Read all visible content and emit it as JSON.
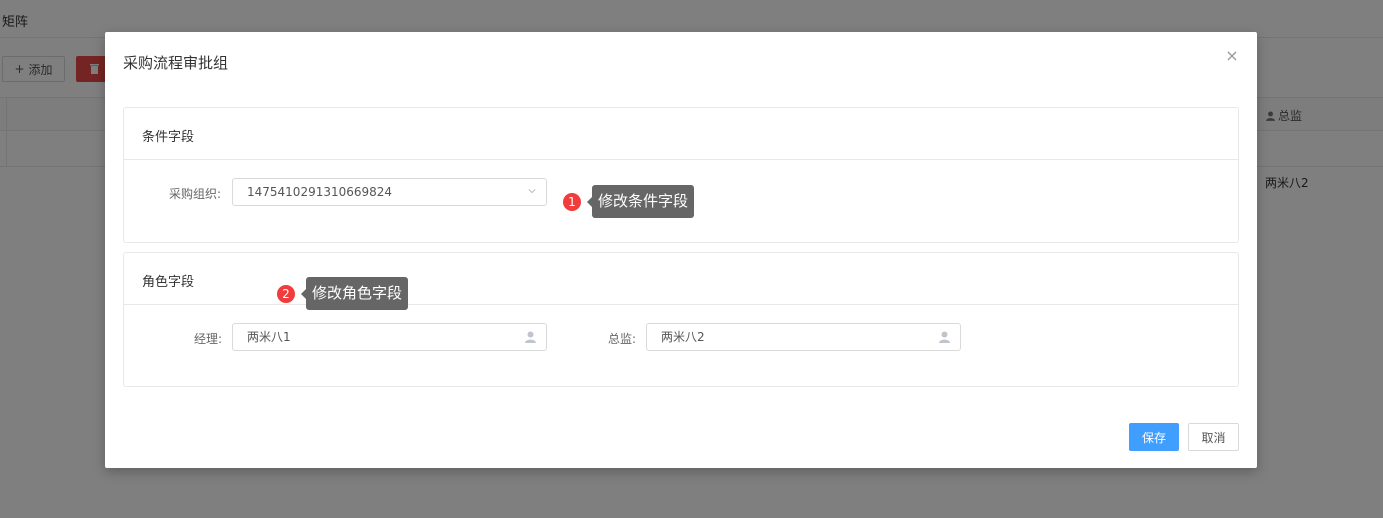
{
  "background": {
    "page_title": "矩阵",
    "add_label": "添加",
    "table_header_director": "总监",
    "table_row_director": "两米八2"
  },
  "modal": {
    "title": "采购流程审批组",
    "close_icon": "×",
    "condition_section": {
      "title": "条件字段",
      "purchase_org_label": "采购组织:",
      "purchase_org_value": "1475410291310669824"
    },
    "role_section": {
      "title": "角色字段",
      "manager_label": "经理:",
      "manager_value": "两米八1",
      "director_label": "总监:",
      "director_value": "两米八2"
    },
    "annotations": [
      {
        "badge": "1",
        "text": "修改条件字段"
      },
      {
        "badge": "2",
        "text": "修改角色字段"
      }
    ],
    "save_label": "保存",
    "cancel_label": "取消"
  },
  "colors": {
    "primary": "#409eff",
    "danger": "#e94b46",
    "badge": "#f23b3b",
    "tooltip": "#666666"
  }
}
